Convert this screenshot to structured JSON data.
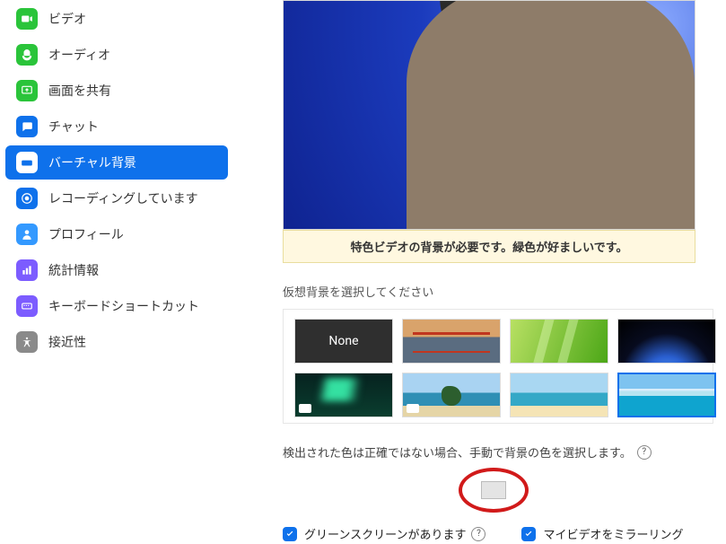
{
  "sidebar": {
    "items": [
      {
        "label": "ビデオ",
        "icon": "video-icon"
      },
      {
        "label": "オーディオ",
        "icon": "audio-icon"
      },
      {
        "label": "画面を共有",
        "icon": "share-screen-icon"
      },
      {
        "label": "チャット",
        "icon": "chat-icon"
      },
      {
        "label": "バーチャル背景",
        "icon": "virtual-background-icon",
        "active": true
      },
      {
        "label": "レコーディングしています",
        "icon": "recording-icon"
      },
      {
        "label": "プロフィール",
        "icon": "profile-icon"
      },
      {
        "label": "統計情報",
        "icon": "statistics-icon"
      },
      {
        "label": "キーボードショートカット",
        "icon": "keyboard-shortcut-icon"
      },
      {
        "label": "接近性",
        "icon": "accessibility-icon"
      }
    ]
  },
  "preview": {
    "warning": "特色ビデオの背景が必要です。緑色が好ましいです。"
  },
  "backgrounds": {
    "section_label": "仮想背景を選択してください",
    "none_label": "None",
    "items": [
      {
        "name": "none"
      },
      {
        "name": "golden-gate-bridge"
      },
      {
        "name": "grass"
      },
      {
        "name": "earth-from-space"
      },
      {
        "name": "aurora",
        "has_video_badge": true
      },
      {
        "name": "tropical-island",
        "has_video_badge": true
      },
      {
        "name": "beach-sunset"
      },
      {
        "name": "ocean-horizon",
        "selected": true
      }
    ]
  },
  "manual_color": {
    "hint": "検出された色は正確ではない場合、手動で背景の色を選択します。"
  },
  "options": {
    "green_screen": {
      "label": "グリーンスクリーンがあります",
      "checked": true
    },
    "mirror": {
      "label": "マイビデオをミラーリング",
      "checked": true
    }
  }
}
